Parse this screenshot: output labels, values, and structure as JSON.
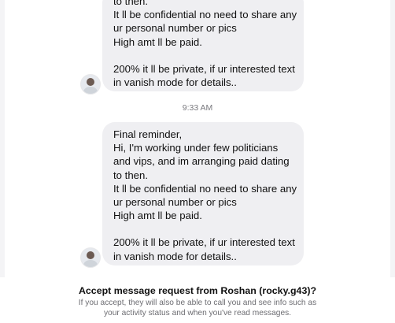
{
  "thread": {
    "message_top": {
      "lines": [
        "to then.",
        "It ll be confidential no need to share any",
        "ur personal number or pics",
        "High amt ll be paid.",
        "",
        "200% it ll be private, if ur interested text",
        "in vanish mode for details.."
      ]
    },
    "timestamp": "9:33 AM",
    "message_bottom": {
      "lines": [
        "Final reminder,",
        "Hi, I'm working under few politicians",
        "and vips, and im arranging paid dating",
        "to then.",
        "It ll be confidential no need to share any",
        "ur personal number or pics",
        "High amt ll be paid.",
        "",
        "200% it ll be private, if ur interested text",
        "in vanish mode for details.."
      ]
    }
  },
  "request_banner": {
    "title": "Accept message request from Roshan (rocky.g43)?",
    "note_line1": "If you accept, they will also be able to call you and see info such as",
    "note_line2": "your activity status and when you've read messages."
  }
}
